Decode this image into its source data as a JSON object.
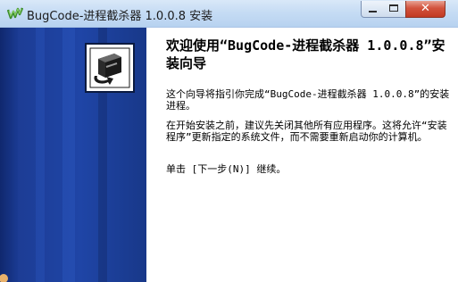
{
  "window": {
    "title": "BugCode-进程截杀器 1.0.0.8 安装",
    "minimize_icon": "minimize-icon",
    "maximize_icon": "maximize-icon",
    "close_glyph": "✕"
  },
  "sidebar": {
    "logo_icon": "installer-logo-icon",
    "background_color": "#1f45a6"
  },
  "wizard": {
    "heading": "欢迎使用“BugCode-进程截杀器 1.0.0.8”安装向导",
    "intro": "这个向导将指引你完成“BugCode-进程截杀器 1.0.0.8”的安装进程。",
    "advice": "在开始安装之前，建议先关闭其他所有应用程序。这将允许“安装程序”更新指定的系统文件，而不需要重新启动你的计算机。",
    "next_hint": "单击 [下一步(N)] 继续。"
  }
}
